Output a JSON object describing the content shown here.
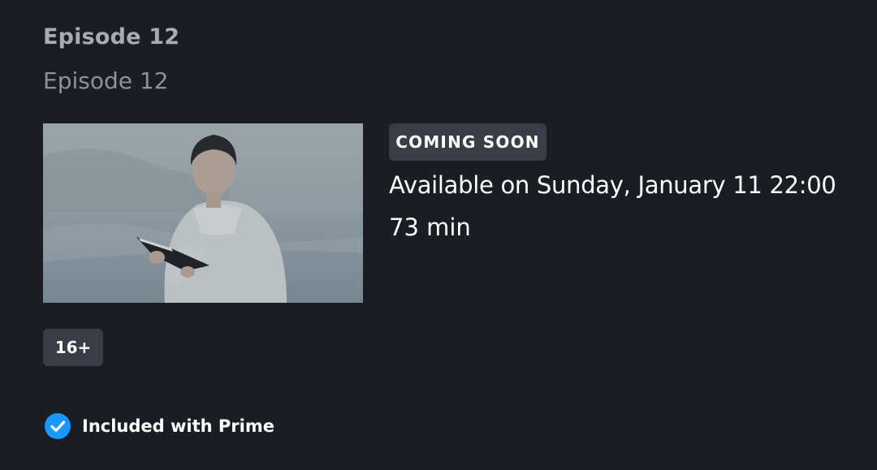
{
  "episode": {
    "heading": "Episode 12",
    "subtitle": "Episode 12",
    "thumbnail_icon": "episode-still-image"
  },
  "status": {
    "badge": "COMING SOON",
    "availability": "Available on Sunday, January 11 22:00",
    "runtime": "73 min"
  },
  "rating": {
    "label": "16+"
  },
  "prime": {
    "label": "Included with Prime",
    "icon": "check-circle-icon",
    "icon_color": "#1a98ff"
  },
  "colors": {
    "background": "#1a1d24",
    "badge_background": "#3a3d45",
    "muted_text": "#a8abb1"
  }
}
